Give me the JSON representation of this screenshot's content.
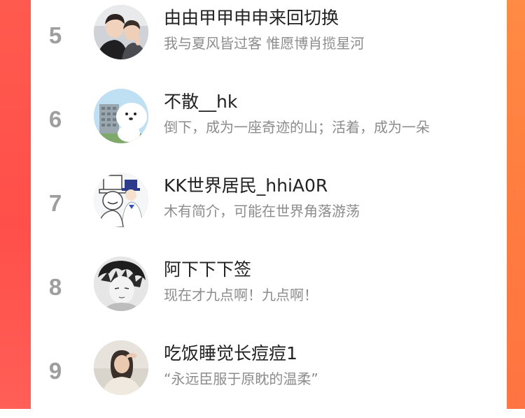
{
  "theme": {
    "rank_color": "#9e9e9e",
    "name_color": "#222222",
    "bio_color": "#8c8c8c",
    "left_edge": "#ff5248",
    "right_edge": "#ff7f42"
  },
  "list": [
    {
      "rank": "5",
      "name": "由由甲甲申申来回切换",
      "bio": "我与夏风皆过客 惟愿博肖揽星河",
      "avatar_icon": "photo-two-people-avatar"
    },
    {
      "rank": "6",
      "name": "不散__hk",
      "bio": "倒下，成为一座奇迹的山；活着，成为一朵",
      "avatar_icon": "cartoon-bear-building-avatar"
    },
    {
      "rank": "7",
      "name": "KK世界居民_hhiA0R",
      "bio": "木有简介，可能在世界角落游荡",
      "avatar_icon": "kaito-kid-anime-avatar"
    },
    {
      "rank": "8",
      "name": "阿下下下签",
      "bio": "现在才九点啊！九点啊！",
      "avatar_icon": "sketch-anime-boy-avatar"
    },
    {
      "rank": "9",
      "name": "吃饭睡觉长痘痘1",
      "bio": "“永远臣服于原眈的温柔”",
      "avatar_icon": "girl-photo-avatar"
    }
  ]
}
